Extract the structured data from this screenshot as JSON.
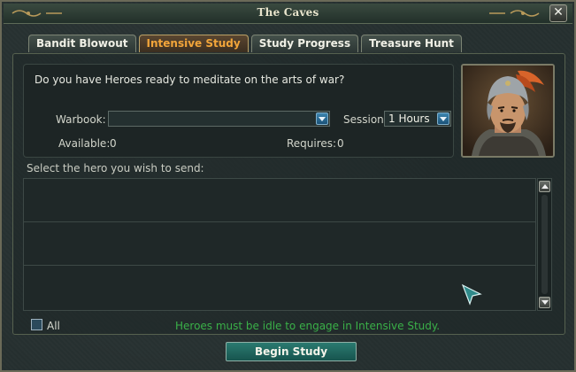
{
  "window": {
    "title": "The Caves",
    "close_label": "✕"
  },
  "tabs": [
    {
      "label": "Bandit Blowout",
      "active": false
    },
    {
      "label": "Intensive Study",
      "active": true
    },
    {
      "label": "Study Progress",
      "active": false
    },
    {
      "label": "Treasure Hunt",
      "active": false
    }
  ],
  "study": {
    "question": "Do you have Heroes ready to meditate on the arts of war?",
    "warbook_label": "Warbook:",
    "warbook_value": "",
    "session_label": "Session:",
    "session_value": "1 Hours",
    "available_label": "Available:",
    "available_value": "0",
    "requires_label": "Requires:",
    "requires_value": "0"
  },
  "hero_list": {
    "prompt": "Select the hero you wish to send:",
    "rows": [
      "",
      "",
      ""
    ]
  },
  "footer": {
    "all_label": "All",
    "hint": "Heroes must be idle to engage in Intensive Study.",
    "begin_button": "Begin Study"
  },
  "colors": {
    "active_tab_text": "#f2a53a",
    "hint_text": "#3ab048",
    "button_teal": "#2b7a70"
  },
  "icons": {
    "close": "close-icon",
    "dropdown": "chevron-down-icon",
    "scroll_up": "arrow-up-icon",
    "scroll_down": "arrow-down-icon",
    "cursor": "mouse-cursor-icon"
  }
}
